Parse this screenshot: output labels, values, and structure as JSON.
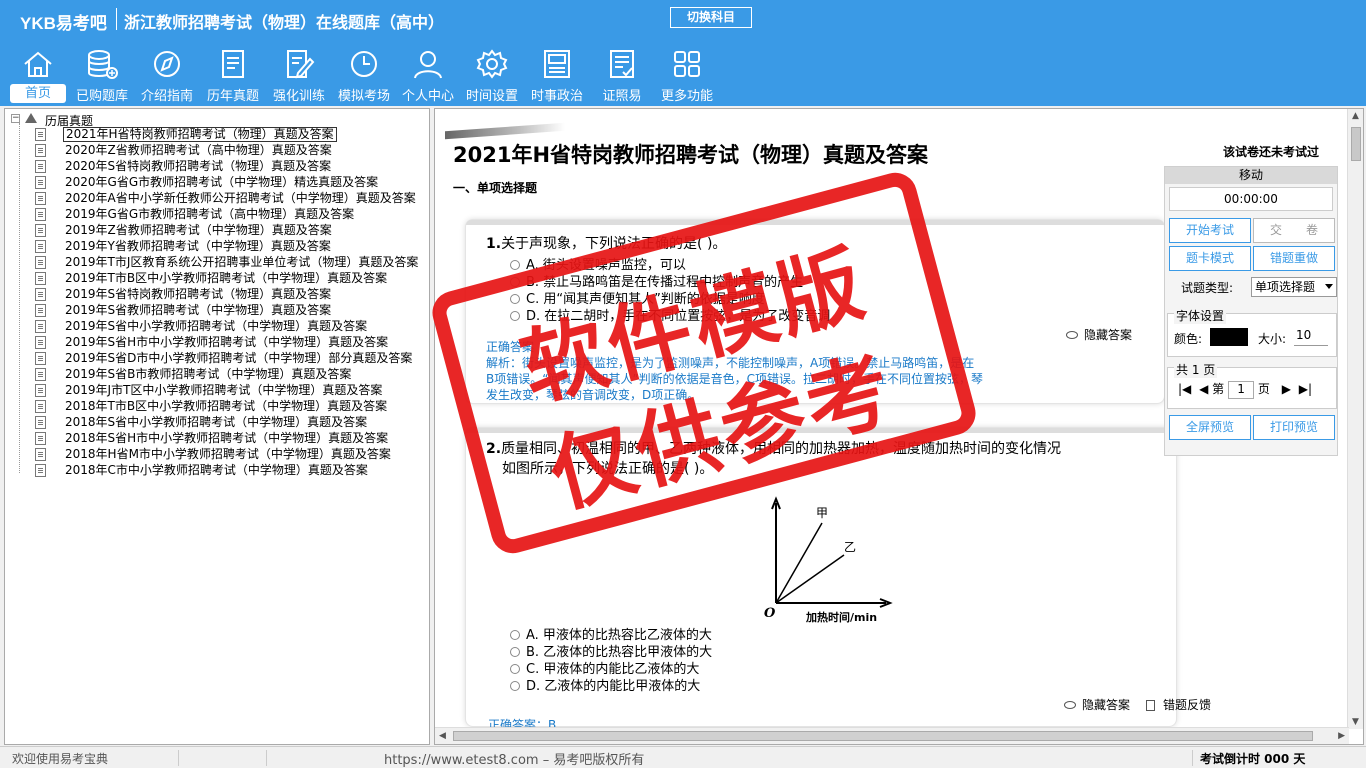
{
  "header": {
    "brand": "YKB易考吧",
    "app_title": "浙江教师招聘考试（物理）在线题库（高中）",
    "switch_subject": "切换科目"
  },
  "nav": [
    {
      "label": "首页",
      "icon": "home-icon"
    },
    {
      "label": "已购题库",
      "icon": "database-add-icon"
    },
    {
      "label": "介绍指南",
      "icon": "compass-icon"
    },
    {
      "label": "历年真题",
      "icon": "document-list-icon"
    },
    {
      "label": "强化训练",
      "icon": "edit-document-icon"
    },
    {
      "label": "模拟考场",
      "icon": "clock-icon"
    },
    {
      "label": "个人中心",
      "icon": "user-icon"
    },
    {
      "label": "时间设置",
      "icon": "gear-icon"
    },
    {
      "label": "时事政治",
      "icon": "newspaper-icon"
    },
    {
      "label": "证照易",
      "icon": "checklist-icon"
    },
    {
      "label": "更多功能",
      "icon": "grid-icon"
    }
  ],
  "tree": {
    "root": "历届真题",
    "items": [
      "2021年H省特岗教师招聘考试（物理）真题及答案",
      "2020年Z省教师招聘考试（高中物理）真题及答案",
      "2020年S省特岗教师招聘考试（物理）真题及答案",
      "2020年G省G市教师招聘考试（中学物理）精选真题及答案",
      "2020年A省中小学新任教师公开招聘考试（中学物理）真题及答案",
      "2019年G省G市教师招聘考试（高中物理）真题及答案",
      "2019年Z省教师招聘考试（中学物理）真题及答案",
      "2019年Y省教师招聘考试（中学物理）真题及答案",
      "2019年T市J区教育系统公开招聘事业单位考试（物理）真题及答案",
      "2019年T市B区中小学教师招聘考试（中学物理）真题及答案",
      "2019年S省特岗教师招聘考试（物理）真题及答案",
      "2019年S省教师招聘考试（中学物理）真题及答案",
      "2019年S省中小学教师招聘考试（中学物理）真题及答案",
      "2019年S省H市中小学教师招聘考试（中学物理）真题及答案",
      "2019年S省D市中小学教师招聘考试（中学物理）部分真题及答案",
      "2019年S省B市教师招聘考试（中学物理）真题及答案",
      "2019年J市T区中小学教师招聘考试（中学物理）真题及答案",
      "2018年T市B区中小学教师招聘考试（中学物理）真题及答案",
      "2018年S省中小学教师招聘考试（中学物理）真题及答案",
      "2018年S省H市中小学教师招聘考试（中学物理）真题及答案",
      "2018年H省M市中小学教师招聘考试（中学物理）真题及答案",
      "2018年C市中小学教师招聘考试（中学物理）真题及答案"
    ]
  },
  "exam": {
    "title": "2021年H省特岗教师招聘考试（物理）真题及答案",
    "status": "该试卷还未考试过",
    "section": "一、单项选择题",
    "q1": {
      "num": "1.",
      "stem": "关于声现象，下列说法正确的是(  )。",
      "options": [
        "A. 街头设置噪声监控，可以",
        "B. 禁止马路鸣笛是在传播过程中控制声音的产生",
        "C. 用“闻其声便知其人”判断的依据是响度",
        "D. 在拉二胡时，手在不同位置按弦，是为了改变音调"
      ],
      "option_prefix_d": "D. 拉二胡时，手在",
      "option_suffix_d": "音调",
      "explain_label": "正确答案",
      "explain_lines": [
        "解析：街头设置噪声监控，是为了监测噪声，不能控制噪声，A项错误。禁止马路鸣笛，是在",
        "B项错误。“闻其声便知其人”判断的依据是音色，C项错误。拉二胡时，手在不同位置按弦，琴",
        "发生改变，琴弦的音调改变，D项正确。"
      ]
    },
    "q2": {
      "num": "2.",
      "stem_line1": "质量相同、初温相同的甲、乙两种液体，用相同的加热器加热，温度随加热时间的变化情况",
      "stem_line2": "如图所示，下列说法正确的是(  )。",
      "graph_labels": {
        "a": "甲",
        "b": "乙",
        "origin": "O",
        "xlabel": "加热时间/min"
      },
      "options": [
        "A. 甲液体的比热容比乙液体的大",
        "B. 乙液体的比热容比甲液体的大",
        "C. 甲液体的内能比乙液体的大",
        "D. 乙液体的内能比甲液体的大"
      ],
      "correct": "正确答案：B"
    },
    "hide_answer": "隐藏答案",
    "error_feedback": "错题反馈"
  },
  "tools": {
    "move": "移动",
    "timer": "00:00:00",
    "start_exam": "开始考试",
    "submit": "交　　卷",
    "card_mode": "题卡模式",
    "wrong_redo": "错题重做",
    "type_label": "试题类型:",
    "type_value": "单项选择题",
    "font_group": "字体设置",
    "color_label": "颜色:",
    "size_label": "大小:",
    "size_value": "10",
    "pages_label": "共 1 页",
    "page_prefix": "第",
    "page_value": "1",
    "page_suffix": "页",
    "fullscreen": "全屏预览",
    "print": "打印预览"
  },
  "watermark": {
    "line1": "软件模版",
    "line2": "仅供参考"
  },
  "status": {
    "welcome": "欢迎使用易考宝典",
    "url": "https://www.etest8.com – 易考吧版权所有",
    "countdown": "考试倒计时 000 天"
  },
  "colors": {
    "header_bg": "#3a9ae6",
    "stamp_red": "#e61414",
    "answer_blue": "#1a7ac8"
  }
}
